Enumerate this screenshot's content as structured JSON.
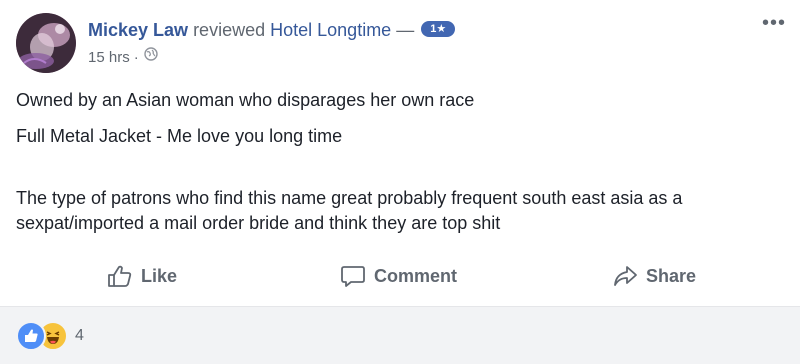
{
  "post": {
    "author": "Mickey Law",
    "verb": "reviewed",
    "target": "Hotel Longtime",
    "dash": "—",
    "rating_badge": "1★",
    "timestamp": "15 hrs",
    "separator": "·",
    "body": {
      "p1": "Owned by an Asian woman who disparages her own race",
      "p2": "Full Metal Jacket - Me love you long time",
      "p3": "The type of patrons who find this name great probably frequent south east asia as a sexpat/imported a mail order bride and think they are top shit"
    },
    "more_icon": "•••"
  },
  "actions": {
    "like": "Like",
    "comment": "Comment",
    "share": "Share"
  },
  "reactions": {
    "types": [
      "like-icon",
      "haha-icon"
    ],
    "count": "4"
  },
  "colors": {
    "link": "#365899",
    "badge": "#4267b2",
    "muted": "#606770",
    "footer_bg": "#f2f3f5"
  }
}
